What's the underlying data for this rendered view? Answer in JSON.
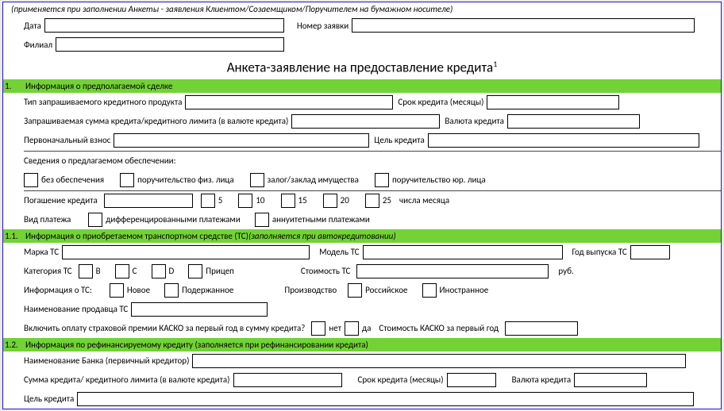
{
  "header": {
    "note": "(применяется при заполнении Анкеты - заявления Клиентом/Созаемщиком/Поручителем на бумажном носителе)",
    "date_lbl": "Дата",
    "appnum_lbl": "Номер заявки",
    "branch_lbl": "Филиал",
    "title": "Анкета-заявление на предоставление кредита",
    "footnote": "1"
  },
  "s1": {
    "num": "1.",
    "title": "Информация о предполагаемой сделке",
    "product_lbl": "Тип запрашиваемого кредитного продукта",
    "term_lbl": "Срок кредита (месяцы)",
    "amount_lbl": "Запрашиваемая сумма кредита/кредитного лимита (в валюте кредита)",
    "currency_lbl": "Валюта кредита",
    "down_lbl": "Первоначальный взнос",
    "purpose_lbl": "Цель кредита",
    "collat_lbl": "Сведения о предлагаемом обеспечении:",
    "collat1": "без обеспечения",
    "collat2": "поручительство физ. лица",
    "collat3": "залог/заклад имущества",
    "collat4": "поручительство юр. лица",
    "repay_lbl": "Погашение кредита",
    "d5": "5",
    "d10": "10",
    "d15": "15",
    "d20": "20",
    "d25": "25",
    "repay_suffix": "числа месяца",
    "paytype_lbl": "Вид платежа",
    "pay1": "дифференцированными платежами",
    "pay2": "аннуитетными платежами"
  },
  "s11": {
    "num": "1.1.",
    "title": "Информация о приобретаемом транспортном средстве (ТС)  ",
    "hint": "(заполняется при автокредитовании)",
    "brand_lbl": "Марка ТС",
    "model_lbl": "Модель ТС",
    "year_lbl": "Год выпуска ТС",
    "cat_lbl": "Категория ТС",
    "cB": "B",
    "cC": "C",
    "cD": "D",
    "cTrailer": "Прицеп",
    "cost_lbl": "Стоимость ТС",
    "rub": "руб.",
    "info_lbl": "Информация о ТС:",
    "new": "Новое",
    "used": "Подержанное",
    "prod_lbl": "Производство",
    "rus": "Российское",
    "foreign": "Иностранное",
    "seller_lbl": "Наименование продавца ТС",
    "kasko_q": "Включить оплату страховой премии КАСКО за первый год в сумму кредита?",
    "no": "нет",
    "yes": "да",
    "kasko_cost_lbl": "Стоимость КАСКО за первый год"
  },
  "s12": {
    "num": "1.2.",
    "title": "Информация по рефинансируемому кредиту (заполняется при рефинансировании кредита)",
    "bank_lbl": "Наименование Банка (первичный кредитор)",
    "amount_lbl": "Сумма кредита/ кредитного лимита (в валюте кредита)",
    "term_lbl": "Срок кредита  (месяцы)",
    "currency_lbl": "Валюта кредита",
    "purpose_lbl": "Цель кредита"
  }
}
